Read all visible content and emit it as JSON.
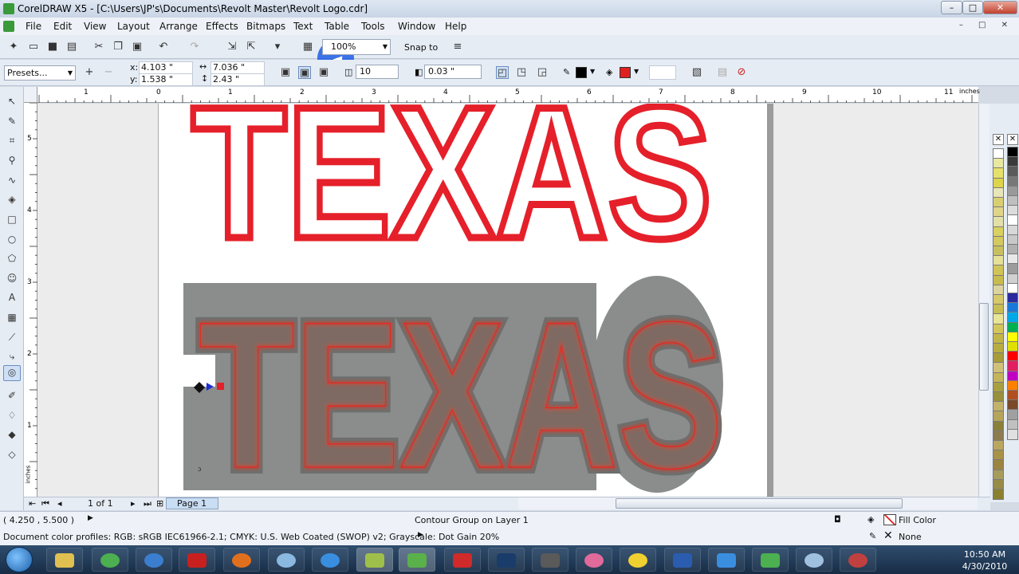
{
  "window": {
    "title": "CorelDRAW X5 - [C:\\Users\\JP's\\Documents\\Revolt Master\\Revolt Logo.cdr]",
    "min_label": "–",
    "max_label": "□",
    "close_label": "✕"
  },
  "menu": {
    "items": [
      "File",
      "Edit",
      "View",
      "Layout",
      "Arrange",
      "Effects",
      "Bitmaps",
      "Text",
      "Table",
      "Tools",
      "Window",
      "Help"
    ],
    "mdi_buttons": "– □ ✕"
  },
  "toolbar": {
    "zoom_value": "100%",
    "snap_to_label": "Snap to"
  },
  "propbar": {
    "presets_label": "Presets...",
    "x_label": "x:",
    "x_value": "4.103 \"",
    "y_label": "y:",
    "y_value": "1.538 \"",
    "w_value": "7.036 \"",
    "h_value": "2.43 \"",
    "steps_value": "10",
    "offset_value": "0.03 \"",
    "outline_color": "#000000",
    "fill_color": "#e02020"
  },
  "rulers": {
    "h_labels": [
      "1",
      "0",
      "1",
      "2",
      "3",
      "4",
      "5",
      "6",
      "7",
      "8",
      "9",
      "10",
      "11"
    ],
    "h_unit": "inches",
    "v_labels": [
      "5",
      "4",
      "3",
      "2",
      "1"
    ],
    "v_unit": "inches"
  },
  "artwork": {
    "word": "TEXAS",
    "outline_color": "#e5202a",
    "contour_color": "#8a8d8c",
    "glow_color": "#e8261e"
  },
  "pagenav": {
    "page_count": "1 of 1",
    "page_tab": "Page 1"
  },
  "status": {
    "coords": "( 4.250 , 5.500 )",
    "object_info": "Contour Group on Layer 1",
    "fill_label": "Fill Color",
    "outline_label": "None",
    "color_profiles": "Document color profiles: RGB: sRGB IEC61966-2.1; CMYK: U.S. Web Coated (SWOP) v2; Grayscale: Dot Gain 20%"
  },
  "palette": {
    "colors_a": [
      "#ffffff",
      "#e8e8a0",
      "#e6e06a",
      "#dcd44a",
      "#e8e6b8",
      "#d8d070",
      "#e0d488",
      "#e2e0a8",
      "#d8d060",
      "#d4c860",
      "#c8c060",
      "#e4e098",
      "#d0c458",
      "#c6bc50",
      "#dcd4a0",
      "#d6c96a",
      "#c8bc54",
      "#e8e498",
      "#d2c65a",
      "#c2b648",
      "#b8ac40",
      "#a89c38",
      "#d0c078",
      "#c4b45c",
      "#a8a040",
      "#98903c",
      "#c2b26a",
      "#b4a45c",
      "#8a803a",
      "#8c7c50",
      "#bba660",
      "#a89248",
      "#9a8440",
      "#a69c5c",
      "#968c48",
      "#8a8030"
    ],
    "colors_b": [
      "#000000",
      "#3a3a3a",
      "#5a5a5a",
      "#787878",
      "#999999",
      "#bfbfbf",
      "#dcdcdc",
      "#ffffff",
      "#d8d8d8",
      "#c8c8c8",
      "#b0b0b0",
      "#e8e8e8",
      "#9c9c9c",
      "#d0d0d0",
      "#ffffff",
      "#2a2aa0",
      "#1a78d8",
      "#00a8e8",
      "#00b050",
      "#ffff00",
      "#e0e000",
      "#ff0000",
      "#e02060",
      "#c000c0",
      "#ff8000",
      "#b05020",
      "#7a4a2a",
      "#a0a0a0",
      "#c0c0c0",
      "#e0e0e0"
    ]
  },
  "taskbar": {
    "time": "10:50 AM",
    "date": "4/30/2010"
  }
}
